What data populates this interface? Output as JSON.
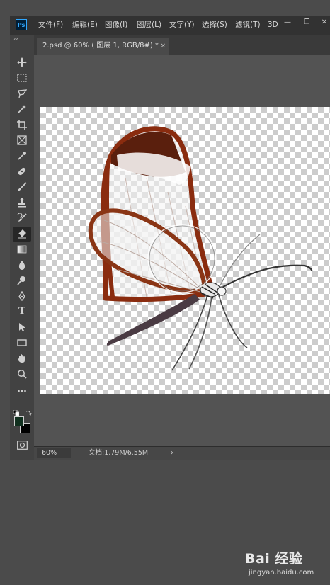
{
  "app": {
    "logo_text": "Ps",
    "accent": "#31a8ff"
  },
  "menu": [
    {
      "label": "文件(F)"
    },
    {
      "label": "编辑(E)"
    },
    {
      "label": "图像(I)"
    },
    {
      "label": "图层(L)"
    },
    {
      "label": "文字(Y)"
    },
    {
      "label": "选择(S)"
    },
    {
      "label": "滤镜(T)"
    },
    {
      "label": "3D"
    }
  ],
  "window_controls": {
    "minimize": "—",
    "restore": "❐",
    "close": "✕"
  },
  "toolbar": {
    "collapse": "››",
    "tools": [
      "move-tool",
      "marquee-tool",
      "lasso-tool",
      "magic-wand-tool",
      "crop-tool",
      "frame-tool",
      "eyedropper-tool",
      "healing-brush-tool",
      "brush-tool",
      "clone-stamp-tool",
      "history-brush-tool",
      "eraser-tool",
      "gradient-tool",
      "blur-tool",
      "dodge-tool",
      "pen-tool",
      "type-tool",
      "path-selection-tool",
      "rectangle-tool",
      "hand-tool",
      "zoom-tool",
      "edit-toolbar"
    ],
    "active_tool": "eraser-tool",
    "type_glyph": "T",
    "foreground_color": "#11301f",
    "background_color": "#000000"
  },
  "document_tab": {
    "title": "2.psd @ 60% ( 图层 1, RGB/8#) *",
    "close": "×"
  },
  "canvas": {
    "layer": "butterfly"
  },
  "status": {
    "zoom": "60%",
    "doc_info": "文档:1.79M/6.55M",
    "arrow": "›"
  },
  "watermark": {
    "brand": "Bai 经验",
    "url": "jingyan.baidu.com"
  }
}
